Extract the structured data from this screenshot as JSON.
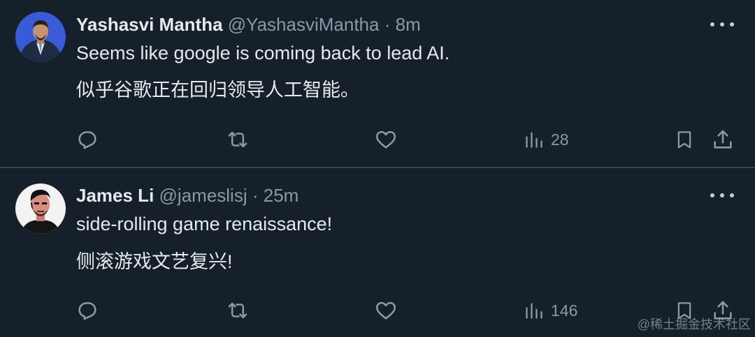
{
  "tweets": [
    {
      "display_name": "Yashasvi Mantha",
      "handle": "@YashasviMantha",
      "separator": "·",
      "time": "8m",
      "text_en": "Seems like google is coming back to lead AI.",
      "text_zh": "似乎谷歌正在回归领导人工智能。",
      "views": "28"
    },
    {
      "display_name": "James Li",
      "handle": "@jameslisj",
      "separator": "·",
      "time": "25m",
      "text_en": "side-rolling game renaissance!",
      "text_zh": "侧滚游戏文艺复兴!",
      "views": "146"
    }
  ],
  "icons": {
    "reply": "reply-icon",
    "retweet": "retweet-icon",
    "like": "heart-icon",
    "views": "views-icon",
    "bookmark": "bookmark-icon",
    "share": "share-icon",
    "more": "more-icon"
  },
  "colors": {
    "background": "#15202b",
    "text": "#e7e9ea",
    "secondary": "#8b98a5",
    "divider": "#38444d"
  },
  "watermark": "@稀土掘金技术社区"
}
